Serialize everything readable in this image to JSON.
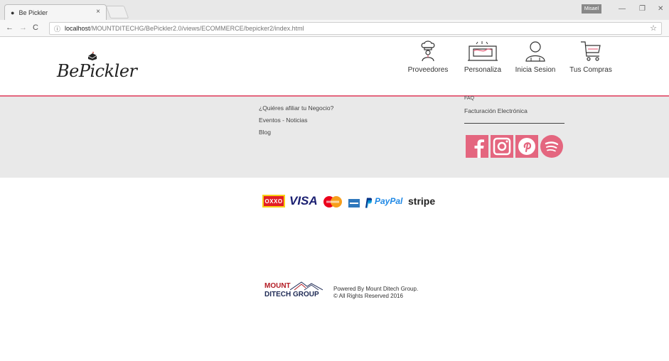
{
  "browser": {
    "tab_title": "Be Pickler",
    "tab_close": "×",
    "profile_label": "Misael",
    "url_host": "localhost",
    "url_path": "/MOUNTDITECHG/BePickler2.0/views/ECOMMERCE/bepicker2/index.html",
    "info_icon": "ⓘ",
    "star": "☆"
  },
  "header": {
    "logo_text": "BePickler",
    "nav": [
      {
        "label": "Proveedores",
        "icon": "chef-icon"
      },
      {
        "label": "Personaliza",
        "icon": "cake-icon"
      },
      {
        "label": "Inicia Sesion",
        "icon": "user-icon"
      },
      {
        "label": "Tus Compras",
        "icon": "cart-icon"
      }
    ],
    "accent_color": "#e4667f"
  },
  "footer": {
    "links_center": [
      "¿Quiéres afiliar tu Negocio?",
      "Eventos - Noticias",
      "Blog"
    ],
    "links_right": [
      "FAQ",
      "Facturación Electrónica"
    ],
    "social": [
      "facebook-icon",
      "instagram-icon",
      "pinterest-icon",
      "spotify-icon"
    ],
    "social_color": "#e4667f"
  },
  "payments": {
    "oxxo": "OXXO",
    "visa": "VISA",
    "paypal": "PayPal",
    "stripe": "stripe"
  },
  "credits": {
    "company_line1": "MOUNT",
    "company_line2": "DITECH GROUP",
    "powered": "Powered By Mount Ditech Group.",
    "rights": "© All Rights Reserved 2016"
  }
}
